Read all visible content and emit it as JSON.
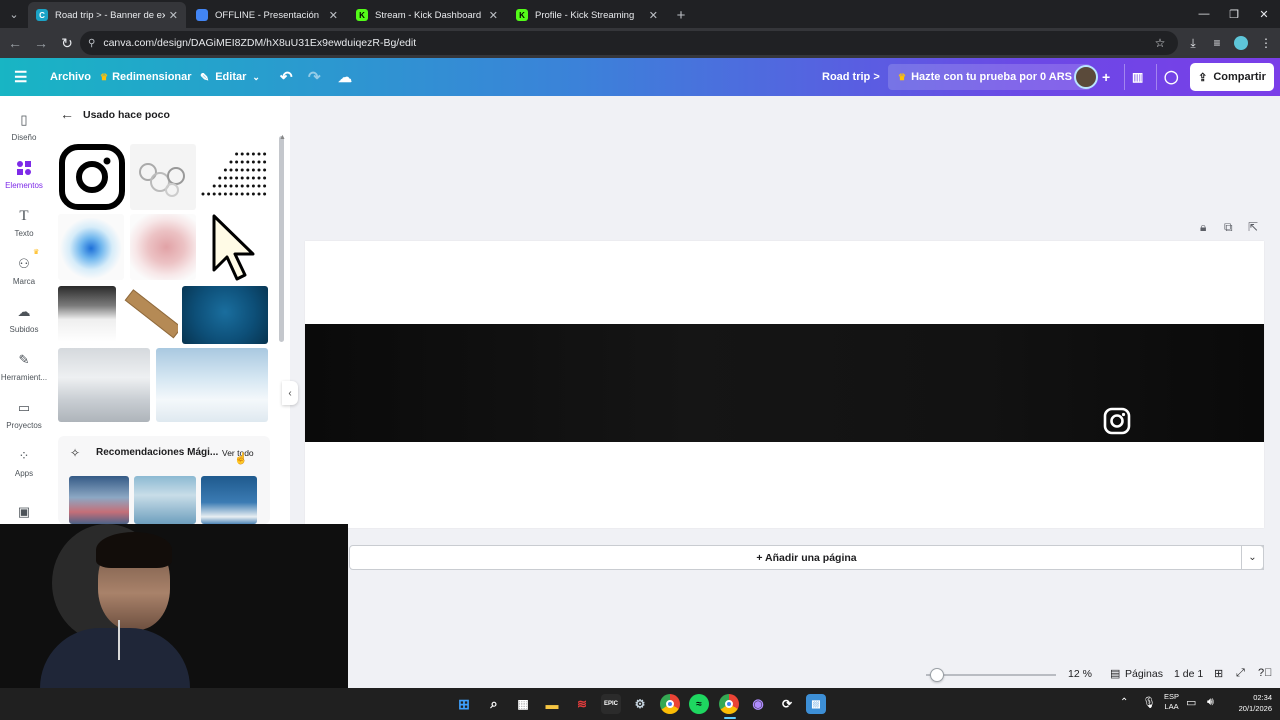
{
  "browser": {
    "tabs": [
      {
        "label": "Road trip > - Banner de exterior",
        "favicon_color": "#1ba3c6",
        "active": true
      },
      {
        "label": "OFFLINE - Presentación",
        "favicon_color": "#4285f4",
        "active": false
      },
      {
        "label": "Stream - Kick Dashboard",
        "favicon_color": "#53fc18",
        "active": false
      },
      {
        "label": "Profile - Kick Streaming",
        "favicon_color": "#53fc18",
        "active": false
      }
    ],
    "url": "canva.com/design/DAGiMEI8ZDM/hX8uU31Ex9ewduiqezR-Bg/edit"
  },
  "header": {
    "file_label": "Archivo",
    "resize_label": "Redimensionar",
    "edit_label": "Editar",
    "design_title": "Road trip >",
    "trial_label": "Hazte con tu prueba por 0 ARS $",
    "share_label": "Compartir",
    "accent_colors": [
      "#18b5c4",
      "#7a3ee8"
    ]
  },
  "rail": {
    "items": [
      {
        "label": "Diseño",
        "icon": "layout-icon"
      },
      {
        "label": "Elementos",
        "icon": "shapes-icon"
      },
      {
        "label": "Texto",
        "icon": "text-icon"
      },
      {
        "label": "Marca",
        "icon": "brand-icon"
      },
      {
        "label": "Subidos",
        "icon": "cloud-upload-icon"
      },
      {
        "label": "Herramient...",
        "icon": "tools-icon"
      },
      {
        "label": "Proyectos",
        "icon": "folder-icon"
      },
      {
        "label": "Apps",
        "icon": "apps-icon"
      }
    ]
  },
  "panel": {
    "title": "Usado hace poco",
    "recommendations_title": "Recomendaciones Mági...",
    "see_all_label": "Ver todo"
  },
  "canvas": {
    "add_page_label": "+ Añadir una página"
  },
  "footer": {
    "zoom_value": "12 %",
    "zoom_level": 0.12,
    "pages_label": "Páginas",
    "page_count": "1 de 1"
  },
  "taskbar": {
    "lang_line1": "ESP",
    "lang_line2": "LAA",
    "time": "02:34",
    "date": "20/1/2026"
  }
}
